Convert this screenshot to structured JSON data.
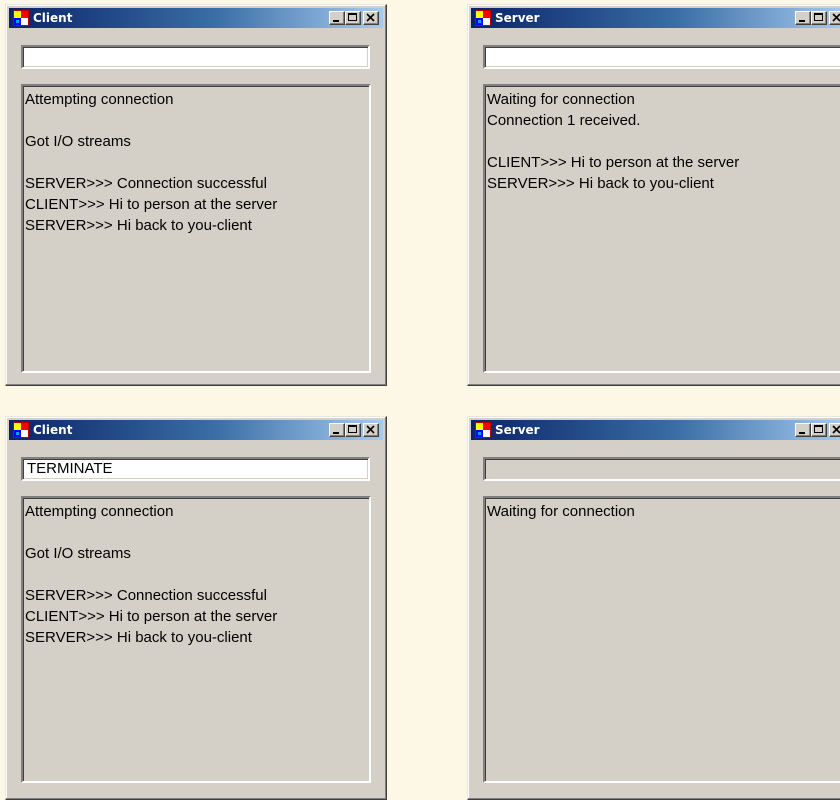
{
  "windows": [
    {
      "title": "Client",
      "input_value": "",
      "input_enabled": true,
      "lines": [
        "Attempting connection",
        "",
        "Got I/O streams",
        "",
        "SERVER>>> Connection successful",
        "CLIENT>>> Hi to person at the server",
        "SERVER>>> Hi back to you-client"
      ]
    },
    {
      "title": "Server",
      "input_value": "",
      "input_enabled": true,
      "lines": [
        "Waiting for connection",
        "Connection 1 received.",
        "",
        "CLIENT>>> Hi to person at the server",
        "SERVER>>> Hi back to you-client"
      ]
    },
    {
      "title": "Client",
      "input_value": "TERMINATE",
      "input_enabled": true,
      "lines": [
        "Attempting connection",
        "",
        "Got I/O streams",
        "",
        "SERVER>>> Connection successful",
        "CLIENT>>> Hi to person at the server",
        "SERVER>>> Hi back to you-client"
      ]
    },
    {
      "title": "Server",
      "input_value": "",
      "input_enabled": false,
      "lines": [
        "Waiting for connection"
      ]
    }
  ],
  "titlebar_buttons": {
    "minimize": "minimize-icon",
    "maximize": "maximize-icon",
    "close": "close-icon"
  },
  "colors": {
    "titlebar_start": "#0a246a",
    "titlebar_end": "#a6caf0",
    "window_face": "#d4d0c8",
    "page_background": "#fdf8e6"
  }
}
